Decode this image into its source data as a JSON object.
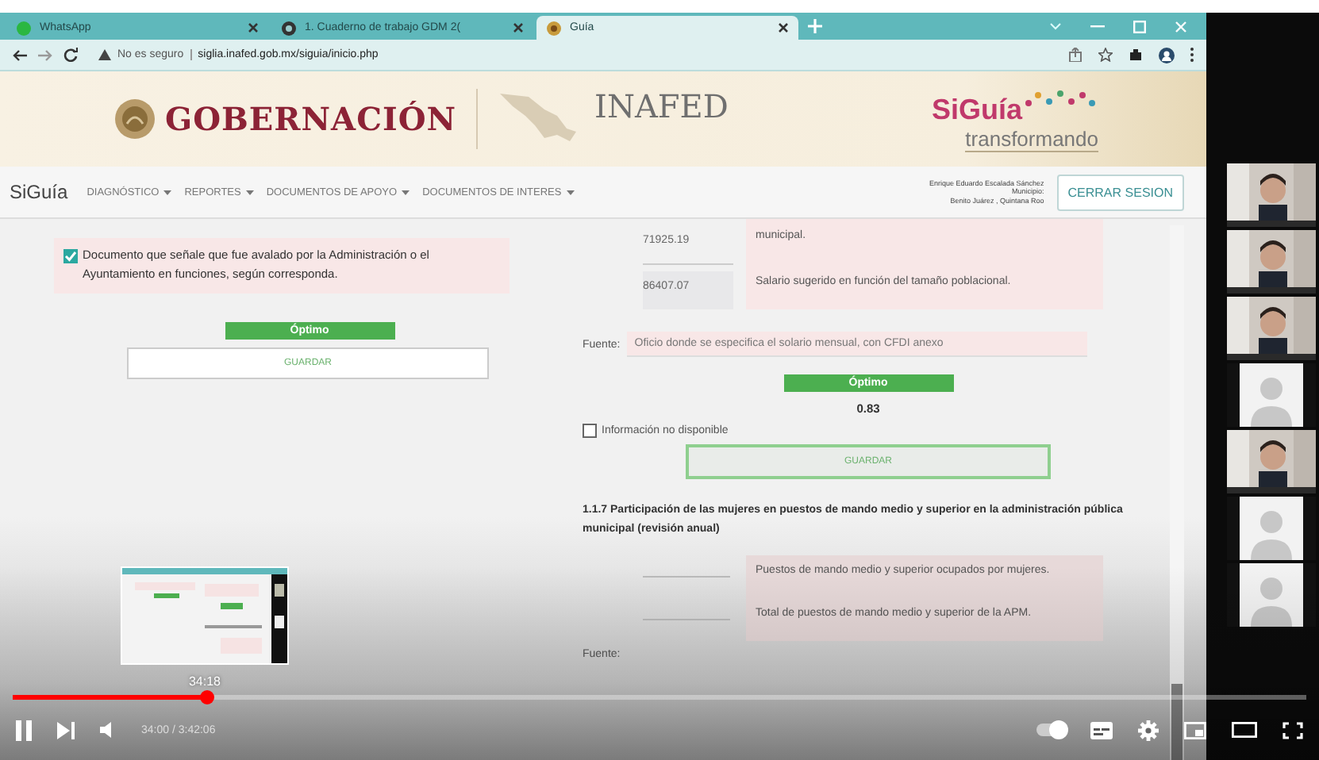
{
  "browser": {
    "tabs": [
      {
        "title": "WhatsApp",
        "kind": "chat",
        "selected": false
      },
      {
        "title": "1. Cuaderno de trabajo GDM 2(",
        "kind": "globe",
        "selected": false
      },
      {
        "title": "Guía",
        "kind": "seal",
        "selected": true
      }
    ],
    "address": {
      "security": "No es seguro",
      "url": "siglia.inafed.gob.mx/siguia/inicio.php"
    }
  },
  "header": {
    "gobernacion": "GOBERNACIÓN",
    "inafed": "INAFED",
    "siguia": "SiGuía",
    "tagline": "transformando"
  },
  "nav": {
    "brand": "SiGuía",
    "menus": [
      "DIAGNÓSTICO",
      "REPORTES",
      "DOCUMENTOS DE APOYO",
      "DOCUMENTOS DE INTERES"
    ],
    "user": [
      "Enrique Eduardo Escalada Sánchez",
      "Municipio:",
      "Benito Juárez , Quintana Roo"
    ],
    "logout": "CERRAR SESION"
  },
  "left": {
    "evidence": {
      "text": "Documento que señale que fue avalado por la Administración o el Ayuntamiento en funciones, según corresponda.",
      "checked": true
    },
    "result": "Óptimo",
    "save": "GUARDAR"
  },
  "right": {
    "rows": [
      {
        "value": "71925.19",
        "label": "municipal."
      },
      {
        "value": "86407.07",
        "label": "Salario sugerido en función del tamaño poblacional."
      }
    ],
    "source_label": "Fuente:",
    "source": "Oficio donde se especifica el solario mensual, con CFDI anexo",
    "result": "Óptimo",
    "score": "0.83",
    "unavailable": {
      "label": "Información no disponible",
      "checked": false
    },
    "save": "GUARDAR",
    "section_title": "1.1.7 Participación de las mujeres en puestos de mando medio y superior en la administración pública municipal (revisión anual)",
    "section_rows": [
      {
        "label": "Puestos de mando medio y superior ocupados por mujeres."
      },
      {
        "label": "Total de puestos de mando medio y superior de la APM."
      }
    ],
    "section_source_label": "Fuente:"
  },
  "participants": [
    {
      "kind": "camera"
    },
    {
      "kind": "camera"
    },
    {
      "kind": "camera"
    },
    {
      "kind": "avatar"
    },
    {
      "kind": "camera"
    },
    {
      "kind": "avatar"
    },
    {
      "kind": "avatar"
    }
  ],
  "player": {
    "hover_time": "34:18",
    "time": "34:00 / 3:42:06",
    "progress": {
      "level": 0.15
    },
    "autoplay": {
      "on": true
    }
  }
}
